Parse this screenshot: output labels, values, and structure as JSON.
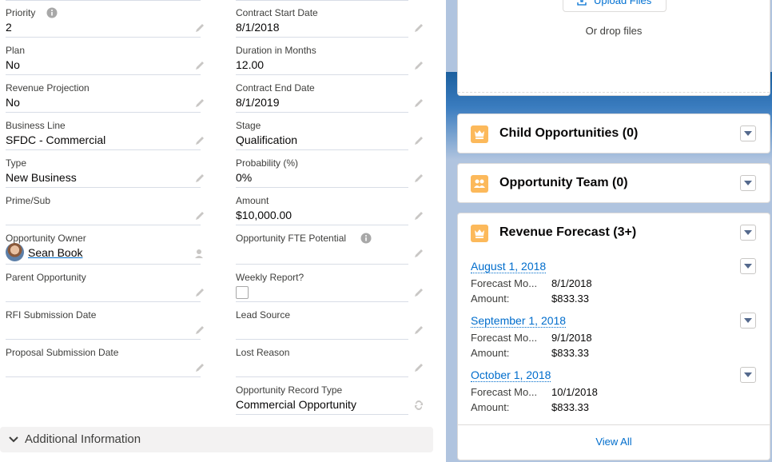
{
  "fields_left": [
    {
      "label": "Priority",
      "value": "2"
    },
    {
      "label": "Plan",
      "value": "No"
    },
    {
      "label": "Revenue Projection",
      "value": "No"
    },
    {
      "label": "Business Line",
      "value": "SFDC - Commercial"
    },
    {
      "label": "Type",
      "value": "New Business"
    },
    {
      "label": "Prime/Sub",
      "value": ""
    },
    {
      "label": "Opportunity Owner",
      "value": "Sean Book"
    },
    {
      "label": "Parent Opportunity",
      "value": ""
    },
    {
      "label": "RFI Submission Date",
      "value": ""
    },
    {
      "label": "Proposal Submission Date",
      "value": ""
    }
  ],
  "fields_right": [
    {
      "label": "Contract Start Date",
      "value": "8/1/2018"
    },
    {
      "label": "Duration in Months",
      "value": "12.00"
    },
    {
      "label": "Contract End Date",
      "value": "8/1/2019"
    },
    {
      "label": "Stage",
      "value": "Qualification"
    },
    {
      "label": "Probability (%)",
      "value": "0%"
    },
    {
      "label": "Amount",
      "value": "$10,000.00"
    },
    {
      "label": "Opportunity FTE Potential",
      "value": ""
    },
    {
      "label": "Weekly Report?",
      "value": ""
    },
    {
      "label": "Lead Source",
      "value": ""
    },
    {
      "label": "Lost Reason",
      "value": ""
    },
    {
      "label": "Opportunity Record Type",
      "value": "Commercial Opportunity"
    }
  ],
  "section": {
    "title": "Additional Information"
  },
  "upload": {
    "button": "Upload Files",
    "drop": "Or drop files"
  },
  "cards": {
    "child": "Child Opportunities (0)",
    "team": "Opportunity Team (0)",
    "forecast": "Revenue Forecast (3+)"
  },
  "forecast_items": [
    {
      "date": "August 1, 2018",
      "k1": "Forecast Mo...",
      "v1": "8/1/2018",
      "k2": "Amount:",
      "v2": "$833.33"
    },
    {
      "date": "September 1, 2018",
      "k1": "Forecast Mo...",
      "v1": "9/1/2018",
      "k2": "Amount:",
      "v2": "$833.33"
    },
    {
      "date": "October 1, 2018",
      "k1": "Forecast Mo...",
      "v1": "10/1/2018",
      "k2": "Amount:",
      "v2": "$833.33"
    }
  ],
  "view_all": "View All",
  "colors": {
    "link": "#006dcc",
    "card_icon": "#fcb95b",
    "team_icon": "#f7b85a"
  }
}
